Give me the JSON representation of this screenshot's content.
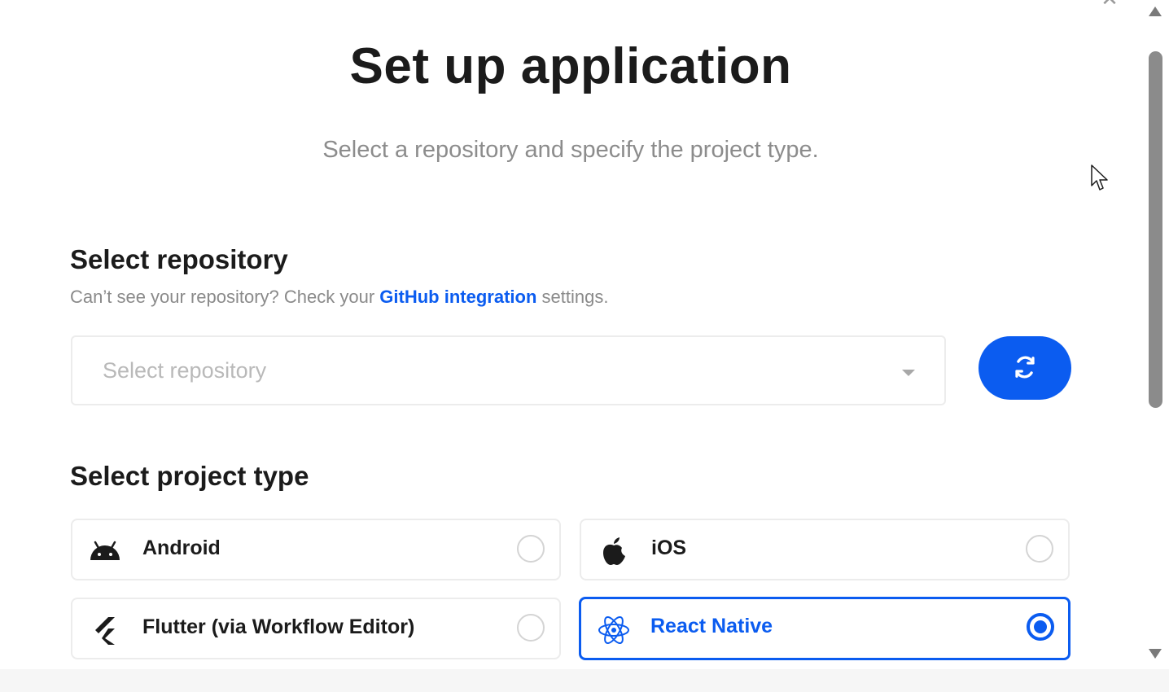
{
  "dialog": {
    "close_glyph": "✕",
    "title": "Set up application",
    "subtitle": "Select a repository and specify the project type."
  },
  "repository": {
    "section_title": "Select repository",
    "hint_prefix": "Can’t see your repository? Check your ",
    "hint_link": "GitHub integration",
    "hint_suffix": " settings.",
    "placeholder": "Select repository"
  },
  "project_type": {
    "section_title": "Select project type",
    "options": [
      {
        "label": "Android",
        "icon": "android-icon",
        "selected": false
      },
      {
        "label": "iOS",
        "icon": "apple-icon",
        "selected": false
      },
      {
        "label": "Flutter (via Workflow Editor)",
        "icon": "flutter-icon",
        "selected": false
      },
      {
        "label": "React Native",
        "icon": "react-icon",
        "selected": true
      }
    ]
  },
  "colors": {
    "accent": "#0b5cf0",
    "text": "#1b1b1b",
    "muted": "#8c8c8c",
    "border": "#ececec"
  }
}
